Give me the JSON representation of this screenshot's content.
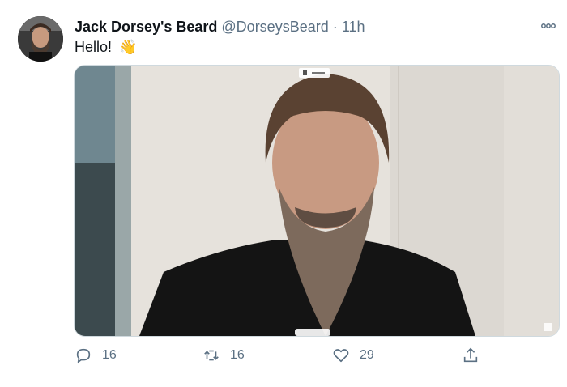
{
  "tweet": {
    "display_name": "Jack Dorsey's Beard",
    "handle": "@DorseysBeard",
    "separator": "·",
    "time": "11h",
    "text": "Hello!",
    "emoji": "👋",
    "media": {
      "video_label": "Jack",
      "description": "video screenshot"
    }
  },
  "actions": {
    "reply_count": "16",
    "retweet_count": "16",
    "like_count": "29"
  },
  "icons": {
    "more": "more-icon",
    "reply": "reply-icon",
    "retweet": "retweet-icon",
    "like": "heart-icon",
    "share": "share-icon"
  },
  "colors": {
    "text": "#0f1419",
    "secondary": "#5b7083",
    "border": "#cfd9de"
  }
}
